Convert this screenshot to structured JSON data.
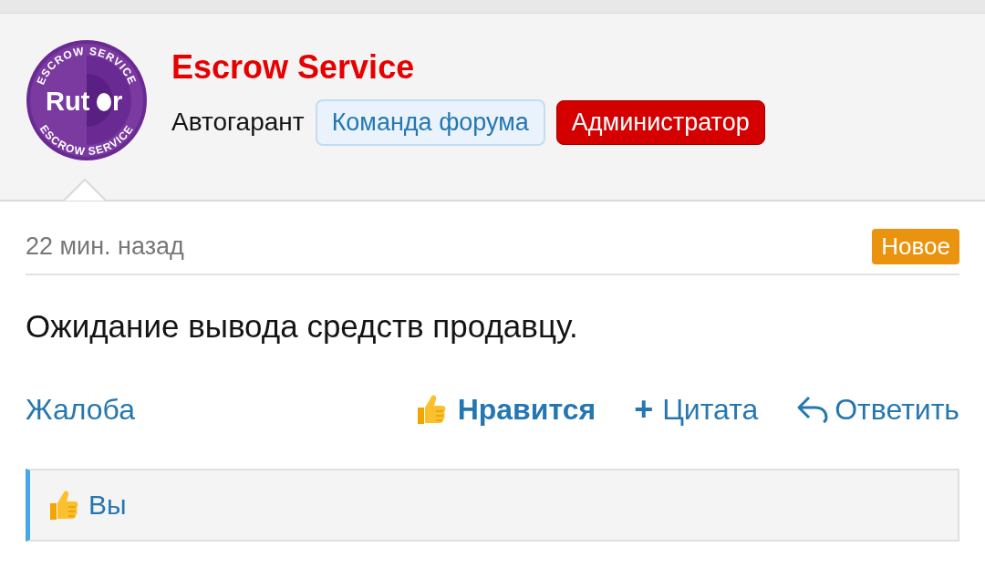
{
  "author": {
    "logo": {
      "ring_top": "ESCROW SERVICE",
      "ring_bottom": "ESCROW SERVICE",
      "wordmark_start": "Rut",
      "wordmark_end": "r"
    },
    "name": "Escrow Service",
    "title": "Автогарант",
    "badges": [
      {
        "label": "Команда форума",
        "kind": "team"
      },
      {
        "label": "Администратор",
        "kind": "admin"
      }
    ]
  },
  "post": {
    "time": "22 мин. назад",
    "badge": "Новое",
    "text": "Ожидание вывода средств продавцу."
  },
  "actions": {
    "report": "Жалоба",
    "like": {
      "label": "Нравится",
      "liked": true
    },
    "quote": {
      "label": "Цитата",
      "icon": "+"
    },
    "reply": "Ответить"
  },
  "likes": {
    "text": "Вы"
  }
}
